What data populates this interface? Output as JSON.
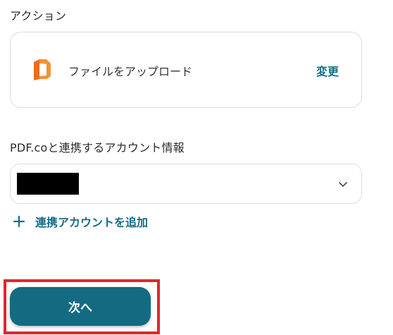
{
  "action_section": {
    "label": "アクション",
    "card": {
      "icon": "pdfco-document-icon",
      "action_name": "ファイルをアップロード",
      "change_label": "変更"
    }
  },
  "account_section": {
    "label": "PDF.coと連携するアカウント情報",
    "select": {
      "value_redacted": true,
      "chevron_icon": "chevron-down-icon"
    },
    "add_account_label": "連携アカウントを追加",
    "add_icon": "plus-icon"
  },
  "footer": {
    "next_label": "次へ"
  },
  "colors": {
    "primary": "#146b81",
    "link": "#176c86",
    "highlight": "#e0262d",
    "icon_orange": "#f26a1b"
  }
}
